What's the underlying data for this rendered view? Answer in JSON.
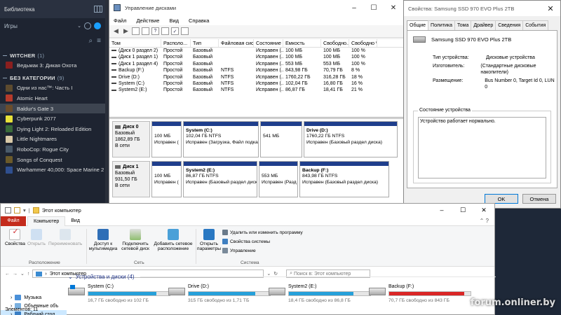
{
  "steam": {
    "library_title": "Библиотека",
    "filter_label": "Игры",
    "categories": [
      {
        "name": "WITCHER",
        "count": "(1)"
      },
      {
        "name": "БЕЗ КАТЕГОРИИ",
        "count": "(9)"
      }
    ],
    "witcher_games": [
      {
        "title": "Ведьмак 3: Дикая Охота",
        "color": "#8b1f1f"
      }
    ],
    "games": [
      {
        "title": "Одни из нас™: Часть I",
        "color": "#5d4b2f"
      },
      {
        "title": "Atomic Heart",
        "color": "#b53b2b"
      },
      {
        "title": "Baldur's Gate 3",
        "color": "#6b4d2b"
      },
      {
        "title": "Cyberpunk 2077",
        "color": "#e8e13a"
      },
      {
        "title": "Dying Light 2: Reloaded Edition",
        "color": "#3a6b3a"
      },
      {
        "title": "Little Nightmares",
        "color": "#d9c9a8"
      },
      {
        "title": "RoboCop: Rogue City",
        "color": "#4a5a6a"
      },
      {
        "title": "Songs of Conquest",
        "color": "#6b5a2a"
      },
      {
        "title": "Warhammer 40,000: Space Marine 2",
        "color": "#2f4f8f"
      }
    ],
    "selected_game": "Baldur's Gate 3"
  },
  "disk_mgmt": {
    "title": "Управление дисками",
    "menu": [
      "Файл",
      "Действие",
      "Вид",
      "Справка"
    ],
    "columns": [
      "Том",
      "Располо...",
      "Тип",
      "Файловая система",
      "Состояние",
      "Емкость",
      "Свободно...",
      "Свободно %"
    ],
    "volumes": [
      [
        "(Диск 0 раздел 2)",
        "Простой",
        "Базовый",
        "",
        "Исправен (...",
        "100 МБ",
        "100 МБ",
        "100 %"
      ],
      [
        "(Диск 1 раздел 1)",
        "Простой",
        "Базовый",
        "",
        "Исправен (...",
        "100 МБ",
        "100 МБ",
        "100 %"
      ],
      [
        "(Диск 1 раздел 4)",
        "Простой",
        "Базовый",
        "",
        "Исправен (...",
        "553 МБ",
        "553 МБ",
        "100 %"
      ],
      [
        "Backup (F:)",
        "Простой",
        "Базовый",
        "NTFS",
        "Исправен (...",
        "843,98 ГБ",
        "70,79 ГБ",
        "8 %"
      ],
      [
        "Drive (D:)",
        "Простой",
        "Базовый",
        "NTFS",
        "Исправен (...",
        "1760,22 ГБ",
        "316,28 ГБ",
        "18 %"
      ],
      [
        "System (C:)",
        "Простой",
        "Базовый",
        "NTFS",
        "Исправен (...",
        "102,04 ГБ",
        "16,80 ГБ",
        "16 %"
      ],
      [
        "System2 (E:)",
        "Простой",
        "Базовый",
        "NTFS",
        "Исправен (...",
        "86,87 ГБ",
        "18,41 ГБ",
        "21 %"
      ]
    ],
    "disks": [
      {
        "name": "Диск 0",
        "type": "Базовый",
        "size": "1862,89 ГБ",
        "status": "В сети",
        "partitions": [
          {
            "name": "",
            "size": "100 МБ",
            "state": "Исправен (",
            "fs": ""
          },
          {
            "name": "System  (C:)",
            "size": "102,04 ГБ NTFS",
            "state": "Исправен (Загрузка, Файл подка",
            "fs": ""
          },
          {
            "name": "",
            "size": "541 МБ",
            "state": "",
            "fs": ""
          },
          {
            "name": "Drive  (D:)",
            "size": "1760,22 ГБ NTFS",
            "state": "Исправен (Базовый раздел диска)",
            "fs": ""
          }
        ]
      },
      {
        "name": "Диск 1",
        "type": "Базовый",
        "size": "931,50 ГБ",
        "status": "В сети",
        "partitions": [
          {
            "name": "",
            "size": "100 МБ",
            "state": "Исправен (",
            "fs": ""
          },
          {
            "name": "System2  (E:)",
            "size": "86,87 ГБ NTFS",
            "state": "Исправен (Базовый раздел диск",
            "fs": ""
          },
          {
            "name": "",
            "size": "553 МБ",
            "state": "Исправен (Разд",
            "fs": ""
          },
          {
            "name": "Backup  (F:)",
            "size": "843,98 ГБ NTFS",
            "state": "Исправен (Базовый раздел диска)",
            "fs": ""
          }
        ]
      }
    ]
  },
  "props": {
    "title": "Свойства: Samsung SSD 970 EVO Plus 2TB",
    "tabs": [
      "Общие",
      "Политика",
      "Тома",
      "Драйвер",
      "Сведения",
      "События"
    ],
    "device_name": "Samsung SSD 970 EVO Plus 2TB",
    "fields": [
      {
        "k": "Тип устройства:",
        "v": "Дисковые устройства"
      },
      {
        "k": "Изготовитель:",
        "v": "(Стандартные дисковые накопители)"
      },
      {
        "k": "Размещение:",
        "v": "Bus Number 0, Target Id 0, LUN 0"
      }
    ],
    "status_group": "Состояние устройства",
    "status_text": "Устройство работает нормально.",
    "ok": "OK",
    "cancel": "Отмена"
  },
  "explorer": {
    "title": "Этот компьютер",
    "ribbon_tabs": [
      "Файл",
      "Компьютер",
      "Вид"
    ],
    "ribbon_buttons": {
      "properties": "Свойства",
      "open": "Открыть",
      "rename": "Переименовать",
      "media_access": "Доступ к мультимедиа",
      "map_drive": "Подключить сетевой диск",
      "add_location": "Добавить сетевое расположение",
      "open_params": "Открыть параметры",
      "uninstall": "Удалить или изменить программу",
      "sys_props": "Свойства системы",
      "manage": "Управление"
    },
    "groups": [
      "Расположение",
      "Сеть",
      "Система"
    ],
    "address": "Этот компьютер",
    "search_placeholder": "Поиск в: Этот компьютер",
    "nav": [
      {
        "label": "Музыка",
        "color": "#4a90d9"
      },
      {
        "label": "Объемные объ",
        "color": "#7ab0e0"
      },
      {
        "label": "Рабочий стол",
        "color": "#3b7fc4"
      }
    ],
    "section": "Устройства и диски (4)",
    "drives": [
      {
        "name": "System (C:)",
        "free": "16,7 ГБ свободно из 102 ГБ",
        "used_pct": 84,
        "win": true
      },
      {
        "name": "Drive (D:)",
        "free": "315 ГБ свободно из 1,71 ТБ",
        "used_pct": 82,
        "win": false
      },
      {
        "name": "System2 (E:)",
        "free": "18,4 ГБ свободно из 86,8 ГБ",
        "used_pct": 79,
        "win": false
      },
      {
        "name": "Backup (F:)",
        "free": "70,7 ГБ свободно из 843 ГБ",
        "used_pct": 92,
        "win": false
      }
    ],
    "items_count": "Элементов: 11"
  },
  "watermark": "forum.onliner.by"
}
